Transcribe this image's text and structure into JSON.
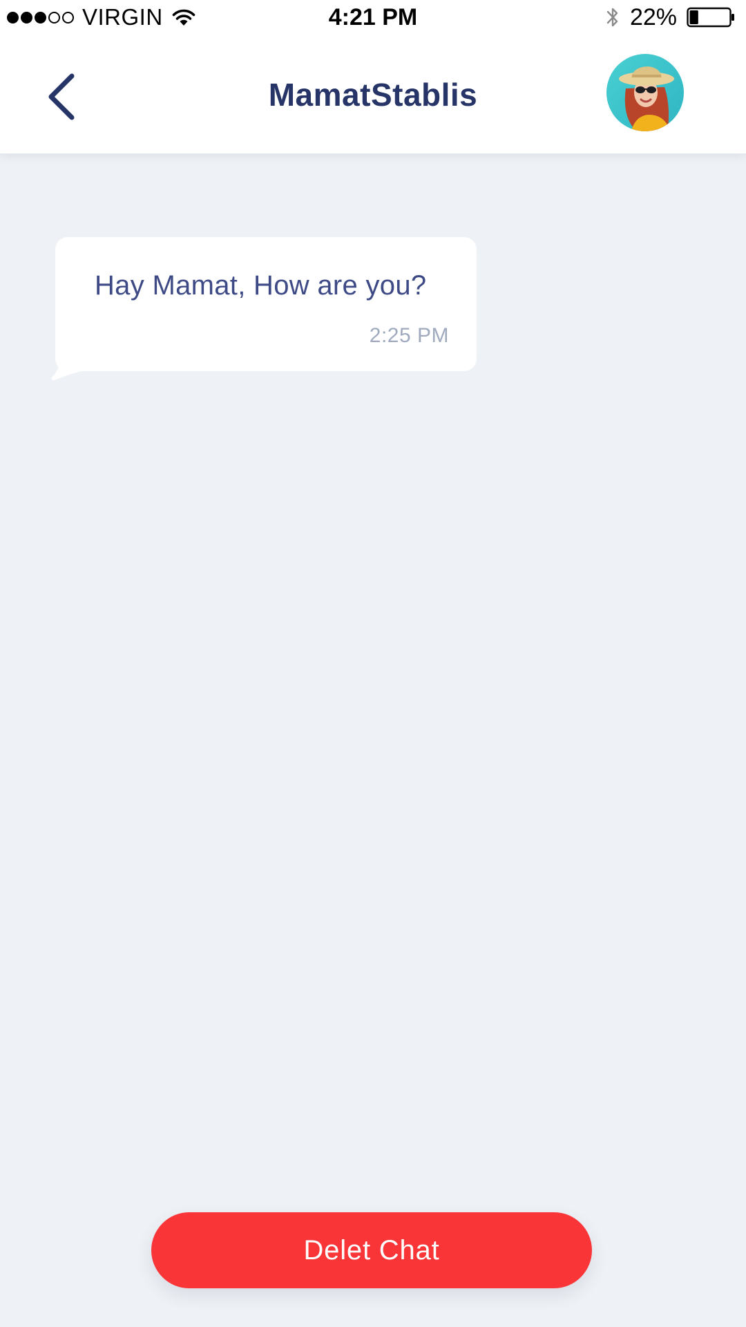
{
  "status_bar": {
    "carrier": "VIRGIN",
    "time": "4:21 PM",
    "battery_percent": "22%",
    "battery_level": 0.22,
    "signal_bars_filled": 3,
    "signal_bars_total": 5,
    "icons": [
      "wifi-icon",
      "bluetooth-icon",
      "battery-icon"
    ]
  },
  "header": {
    "title": "MamatStablis",
    "back_icon": "chevron-left-icon",
    "avatar_icon": "user-avatar"
  },
  "messages": [
    {
      "text": "Hay Mamat, How are you?",
      "time": "2:25 PM"
    }
  ],
  "actions": {
    "delete_label": "Delet Chat"
  },
  "colors": {
    "background": "#eef1f5",
    "title": "#263468",
    "message_text": "#3d4a86",
    "time_text": "#a0aabf",
    "delete_button": "#f93538"
  }
}
